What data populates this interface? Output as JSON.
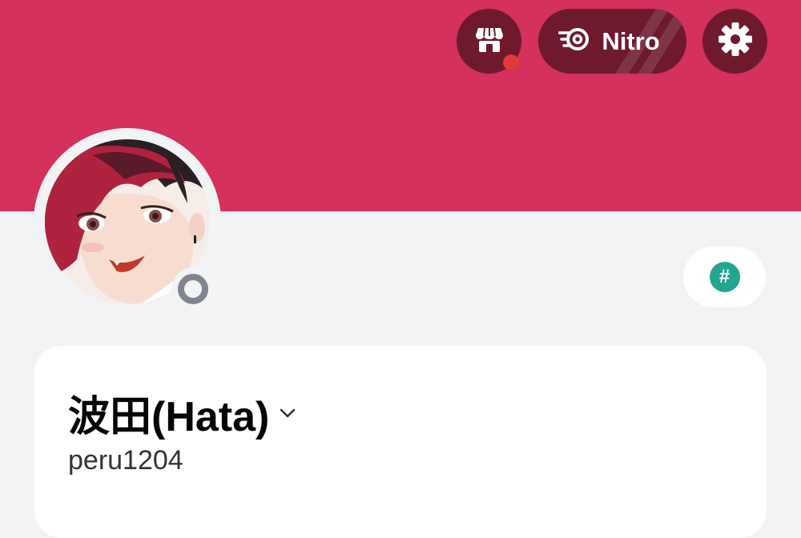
{
  "colors": {
    "banner": "#d4315c",
    "button_bg": "#6e1a2c",
    "notification_dot": "#e03a3a",
    "status_offline": "#80848e",
    "hash_badge": "#23a58f",
    "page_bg": "#f2f3f5",
    "card_bg": "#ffffff"
  },
  "header": {
    "shop_icon": "shop-icon",
    "nitro_icon": "nitro-icon",
    "nitro_label": "Nitro",
    "settings_icon": "gear-icon"
  },
  "profile": {
    "status": "offline",
    "badge_icon": "hash-icon",
    "badge_symbol": "#",
    "display_name": "波田(Hata)",
    "username": "peru1204"
  }
}
